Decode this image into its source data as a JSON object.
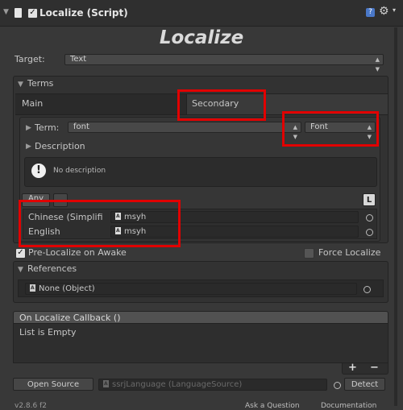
{
  "header": {
    "component_title": "Localize (Script)",
    "big_title": "Localize"
  },
  "target": {
    "label": "Target:",
    "value": "Text"
  },
  "terms": {
    "section_label": "Terms",
    "main_label": "Main",
    "secondary_label": "Secondary",
    "term_label": "Term:",
    "term_value": "font",
    "term_type": "Font",
    "description_label": "Description",
    "no_description": "No description",
    "any_tab": "Any",
    "l_button": "L",
    "languages": [
      {
        "name": "Chinese (Simplifi",
        "value": "msyh"
      },
      {
        "name": "English",
        "value": "msyh"
      }
    ]
  },
  "options": {
    "pre_localize_label": "Pre-Localize on Awake",
    "pre_localize_checked": true,
    "force_localize_label": "Force Localize",
    "force_localize_checked": false
  },
  "references": {
    "section_label": "References",
    "value": "None (Object)"
  },
  "callback": {
    "header": "On Localize Callback ()",
    "empty_text": "List is Empty",
    "add_button": "+",
    "remove_button": "−"
  },
  "footer": {
    "open_source_button": "Open Source",
    "language_source": "ssrjLanguage (LanguageSource)",
    "detect_button": "Detect",
    "version": "v2.8.6 f2",
    "ask_question": "Ask a Question",
    "documentation": "Documentation"
  }
}
